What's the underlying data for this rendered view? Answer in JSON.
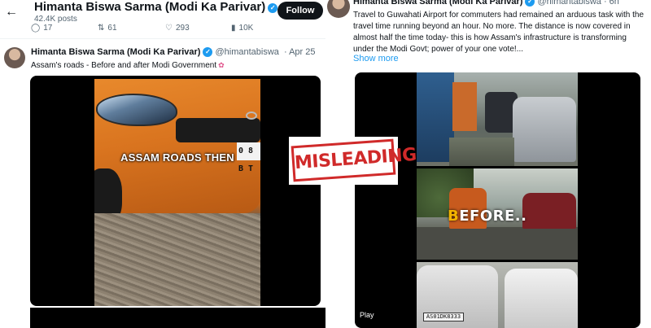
{
  "left_post": {
    "header": {
      "back_icon": "back-arrow-icon",
      "name": "Himanta Biswa Sarma (Modi Ka Parivar)",
      "posts_count": "42.4K posts",
      "follow_label": "Follow"
    },
    "actions": {
      "replies": "17",
      "reposts": "61",
      "likes": "293",
      "views": "10K"
    },
    "tweet": {
      "author_name": "Himanta Biswa Sarma (Modi Ka Parivar)",
      "handle": "@himantabiswa",
      "date": "· Apr 25",
      "text": "Assam's roads - Before and after Modi Government",
      "emoji_icon": "brain-icon"
    },
    "media": {
      "overlay_text": "ASSAM ROADS THEN",
      "plate_text": "0 8 B T"
    }
  },
  "right_post": {
    "tweet": {
      "author_name": "Himanta Biswa Sarma (Modi Ka Parivar)",
      "handle": "@himantabiswa · 6h",
      "text": "Travel to Guwahati Airport for commuters had remained an arduous task with the travel time running beyond an hour. No more. The distance is now covered in almost half the time today- this is how Assam's infrastructure is transforming under the Modi Govt; power of your one vote!...",
      "show_more": "Show more"
    },
    "media": {
      "before_first": "B",
      "before_rest": "EFORE..",
      "plate_text": "AS01DK8333",
      "play_label": "Play"
    }
  },
  "stamp": {
    "label": "MISLEADING",
    "color": "#d02a2a"
  },
  "colors": {
    "accent_blue": "#1d9bf0",
    "text_primary": "#0f1419",
    "text_secondary": "#536471"
  }
}
